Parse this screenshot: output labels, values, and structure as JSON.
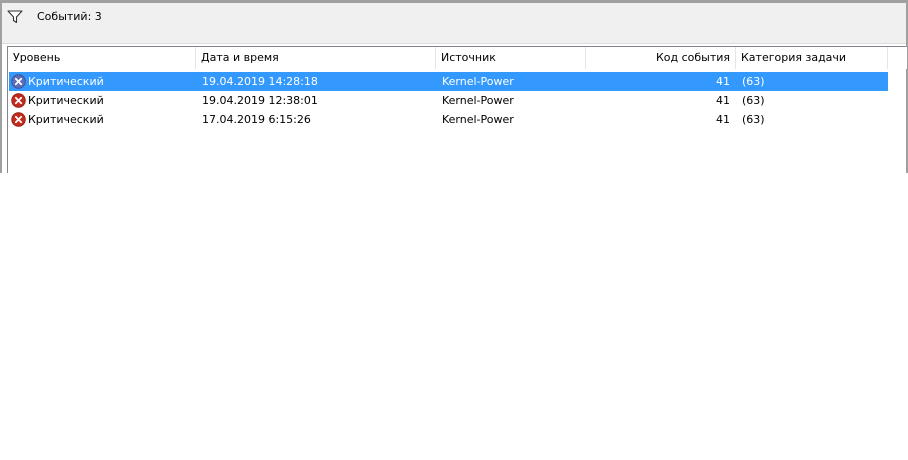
{
  "filter_bar": {
    "icon": "funnel-icon",
    "events_count_label": "Событий: 3"
  },
  "columns": [
    {
      "key": "level",
      "label": "Уровень"
    },
    {
      "key": "datetime",
      "label": "Дата и время"
    },
    {
      "key": "source",
      "label": "Источник"
    },
    {
      "key": "event_id",
      "label": "Код события"
    },
    {
      "key": "task_category",
      "label": "Категория задачи"
    }
  ],
  "events": [
    {
      "level": "Критический",
      "icon": "critical-error-icon",
      "datetime": "19.04.2019 14:28:18",
      "source": "Kernel-Power",
      "event_id": "41",
      "task_category": "(63)",
      "selected": true
    },
    {
      "level": "Критический",
      "icon": "critical-error-icon",
      "datetime": "19.04.2019 12:38:01",
      "source": "Kernel-Power",
      "event_id": "41",
      "task_category": "(63)",
      "selected": false
    },
    {
      "level": "Критический",
      "icon": "critical-error-icon",
      "datetime": "17.04.2019 6:15:26",
      "source": "Kernel-Power",
      "event_id": "41",
      "task_category": "(63)",
      "selected": false
    }
  ],
  "colors": {
    "selection": "#3399ff",
    "critical_icon": "#c42b1c",
    "critical_icon_selected": "#5a6fb8"
  }
}
